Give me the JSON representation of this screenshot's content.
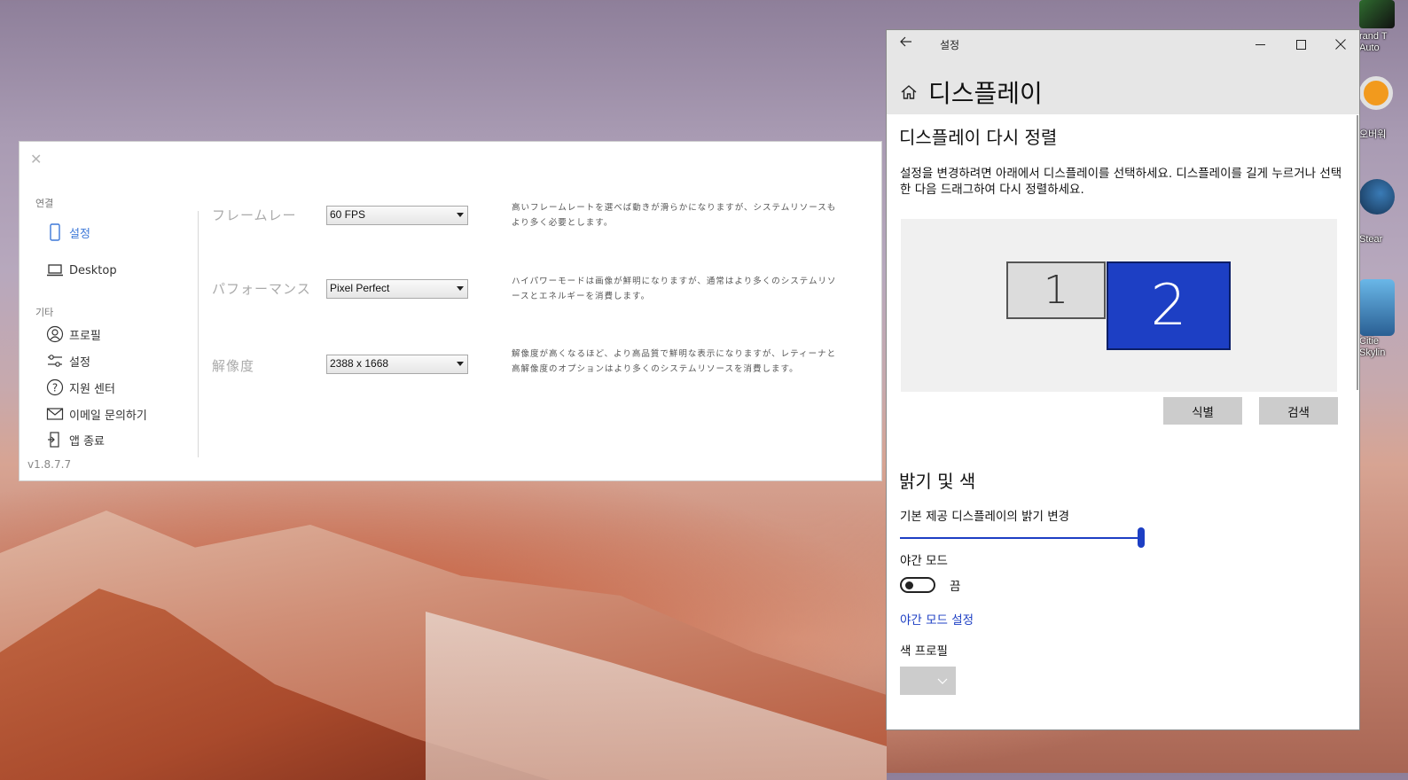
{
  "desktop": {
    "icons": [
      {
        "label": "rand T\nAuto"
      },
      {
        "label": "오버워"
      },
      {
        "label": "Stear"
      },
      {
        "label": "Citie\nSkylin"
      }
    ]
  },
  "app": {
    "sidebar": {
      "section1": "연결",
      "items1": [
        {
          "label": "설정"
        },
        {
          "label": "Desktop"
        }
      ],
      "section2": "기타",
      "items2": [
        {
          "label": "프로필"
        },
        {
          "label": "설정"
        },
        {
          "label": "지원 센터"
        },
        {
          "label": "이메일 문의하기"
        },
        {
          "label": "앱 종료"
        }
      ],
      "version": "v1.8.7.7"
    },
    "settings": [
      {
        "label": "フレームレー",
        "value": "60 FPS",
        "desc": "高いフレームレートを選べば動きが滑らかになりますが、システムリソースもより多く必要とします。"
      },
      {
        "label": "パフォーマンス",
        "value": "Pixel Perfect",
        "desc": "ハイパワーモードは画像が鮮明になりますが、通常はより多くのシステムリソースとエネルギーを消費します。"
      },
      {
        "label": "解像度",
        "value": "2388 x 1668",
        "desc": "解像度が高くなるほど、より高品質で鮮明な表示になりますが、レティーナと高解像度のオプションはより多くのシステムリソースを消費します。"
      }
    ]
  },
  "settingsWindow": {
    "title": "설정",
    "pageTitle": "디스플레이",
    "arrangeHeading": "디스플레이 다시 정렬",
    "arrangeText": "설정을 변경하려면 아래에서 디스플레이를 선택하세요. 디스플레이를 길게 누르거나 선택한 다음 드래그하여 다시 정렬하세요.",
    "monitor1": "1",
    "monitor2": "2",
    "identifyButton": "식별",
    "detectButton": "검색",
    "brightnessHeading": "밝기 및 색",
    "brightnessLabel": "기본 제공 디스플레이의 밝기 변경",
    "brightnessValue": 1.0,
    "nightModeLabel": "야간 모드",
    "nightModeState": "끔",
    "nightModeLink": "야간 모드 설정",
    "colorProfileLabel": "색 프로필",
    "accent": "#1d3fc4"
  }
}
